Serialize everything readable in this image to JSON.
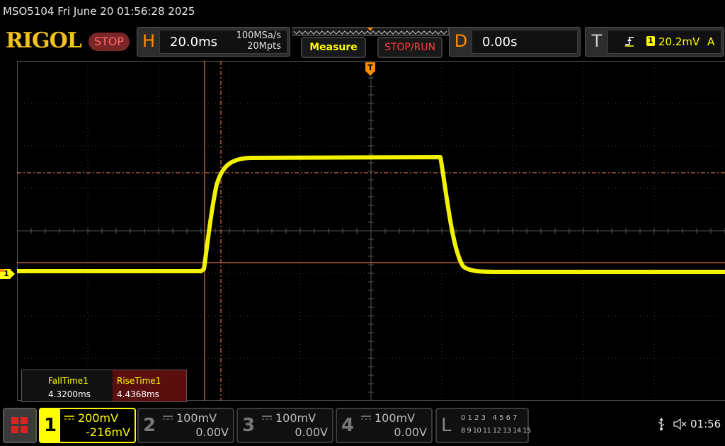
{
  "title": "MSO5104  Fri June 20 01:56:28 2025",
  "logo": "RIGOL",
  "status": "STOP",
  "horizontal": {
    "tag": "H",
    "timebase": "20.0ms",
    "sample_rate": "100MSa/s",
    "memory_depth": "20Mpts"
  },
  "buttons": {
    "measure": "Measure",
    "stop_run": "STOP/RUN"
  },
  "delay": {
    "tag": "D",
    "value": "0.00s"
  },
  "trigger": {
    "tag": "T",
    "channel": "1",
    "level": "20.2mV",
    "mode": "A"
  },
  "trigger_marker": "T",
  "channel_marker": "1",
  "measurements": [
    {
      "name": "FallTime1",
      "value": "4.3200ms"
    },
    {
      "name": "RiseTime1",
      "value": "4.4368ms"
    }
  ],
  "channels": [
    {
      "num": "1",
      "scale": "200mV",
      "offset": "-216mV",
      "active": true
    },
    {
      "num": "2",
      "scale": "100mV",
      "offset": "0.00V",
      "active": false
    },
    {
      "num": "3",
      "scale": "100mV",
      "offset": "0.00V",
      "active": false
    },
    {
      "num": "4",
      "scale": "100mV",
      "offset": "0.00V",
      "active": false
    }
  ],
  "logic": {
    "tag": "L",
    "row1": "0 1 2 3   4 5 6 7",
    "row2": "8 9 10 11 12 13 14 15"
  },
  "clock": "01:56",
  "colors": {
    "ch1": "#ffff00",
    "cursor": "#ff8c5a",
    "accent_orange": "#ff8c00",
    "measure_text": "#ffff00",
    "stop_red": "#ff3b3b"
  }
}
